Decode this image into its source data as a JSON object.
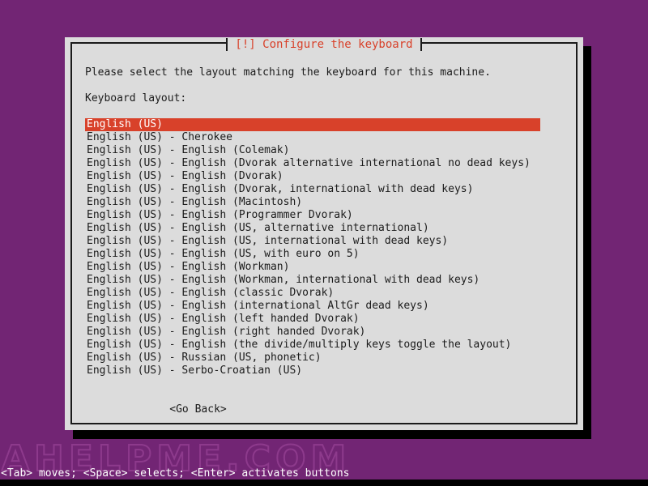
{
  "screen": {
    "background_color": "#722574",
    "watermark_text": "AHELPME.COM"
  },
  "dialog": {
    "title": "[!] Configure the keyboard",
    "title_color": "#d8412a",
    "background_color": "#dcdcdc",
    "border_color": "#1a1a1a",
    "prompt": "Please select the layout matching the keyboard for this machine.",
    "field_label": "Keyboard layout:",
    "selected_index": 0,
    "highlight_color": "#d8412a",
    "items": [
      "English (US)",
      "English (US) - Cherokee",
      "English (US) - English (Colemak)",
      "English (US) - English (Dvorak alternative international no dead keys)",
      "English (US) - English (Dvorak)",
      "English (US) - English (Dvorak, international with dead keys)",
      "English (US) - English (Macintosh)",
      "English (US) - English (Programmer Dvorak)",
      "English (US) - English (US, alternative international)",
      "English (US) - English (US, international with dead keys)",
      "English (US) - English (US, with euro on 5)",
      "English (US) - English (Workman)",
      "English (US) - English (Workman, international with dead keys)",
      "English (US) - English (classic Dvorak)",
      "English (US) - English (international AltGr dead keys)",
      "English (US) - English (left handed Dvorak)",
      "English (US) - English (right handed Dvorak)",
      "English (US) - English (the divide/multiply keys toggle the layout)",
      "English (US) - Russian (US, phonetic)",
      "English (US) - Serbo-Croatian (US)"
    ],
    "go_back_button": "<Go Back>"
  },
  "statusbar": {
    "text": "<Tab> moves; <Space> selects; <Enter> activates buttons",
    "color": "#ffffff"
  }
}
